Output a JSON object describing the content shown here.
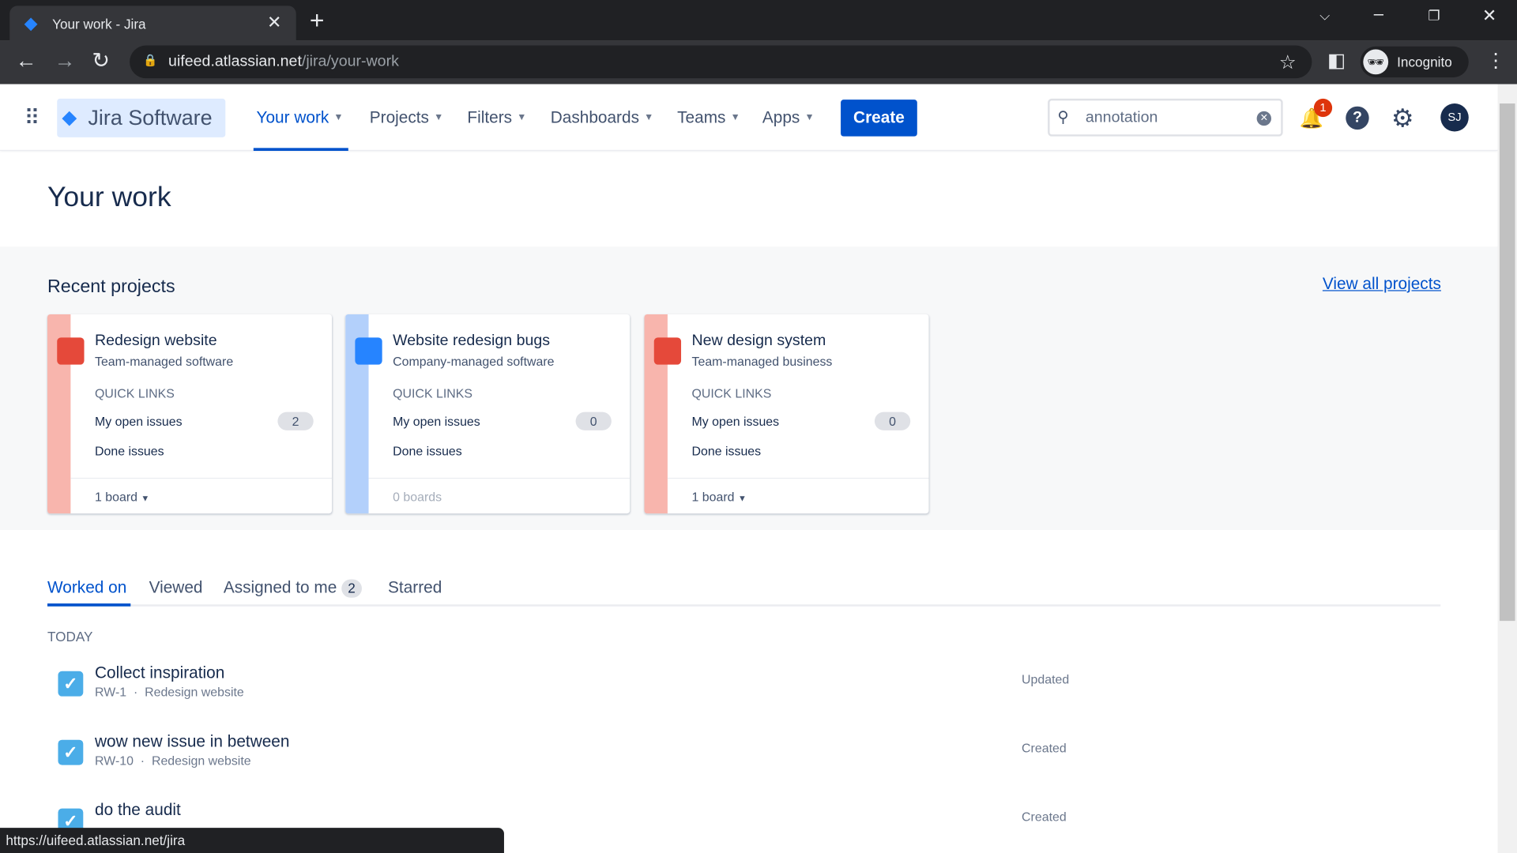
{
  "browser": {
    "tab_title": "Your work - Jira",
    "url_host": "uifeed.atlassian.net",
    "url_path": "/jira/your-work",
    "profile": "Incognito",
    "status_url": "https://uifeed.atlassian.net/jira"
  },
  "nav": {
    "product": "Jira Software",
    "items": [
      "Your work",
      "Projects",
      "Filters",
      "Dashboards",
      "Teams",
      "Apps"
    ],
    "create": "Create",
    "search_value": "annotation",
    "notification_count": "1",
    "avatar": "SJ"
  },
  "page": {
    "title": "Your work",
    "recent_projects": "Recent projects",
    "view_all": "View all projects"
  },
  "projects": [
    {
      "name": "Redesign website",
      "type": "Team-managed software",
      "quick_links": "QUICK LINKS",
      "open": "My open issues",
      "open_count": "2",
      "done": "Done issues",
      "boards": "1 board",
      "stripe": "#f8b5ad",
      "icon_color": "#e5493a"
    },
    {
      "name": "Website redesign bugs",
      "type": "Company-managed software",
      "quick_links": "QUICK LINKS",
      "open": "My open issues",
      "open_count": "0",
      "done": "Done issues",
      "boards": "0 boards",
      "stripe": "#b3d0fb",
      "icon_color": "#2684ff"
    },
    {
      "name": "New design system",
      "type": "Team-managed business",
      "quick_links": "QUICK LINKS",
      "open": "My open issues",
      "open_count": "0",
      "done": "Done issues",
      "boards": "1 board",
      "stripe": "#f8b5ad",
      "icon_color": "#e5493a"
    }
  ],
  "work_tabs": {
    "worked_on": "Worked on",
    "viewed": "Viewed",
    "assigned": "Assigned to me",
    "assigned_count": "2",
    "starred": "Starred"
  },
  "section": "TODAY",
  "items": [
    {
      "title": "Collect inspiration",
      "key": "RW-1",
      "project": "Redesign website",
      "status": "Updated"
    },
    {
      "title": "wow new issue in between",
      "key": "RW-10",
      "project": "Redesign website",
      "status": "Created"
    },
    {
      "title": "do the audit",
      "status": "Created"
    }
  ]
}
